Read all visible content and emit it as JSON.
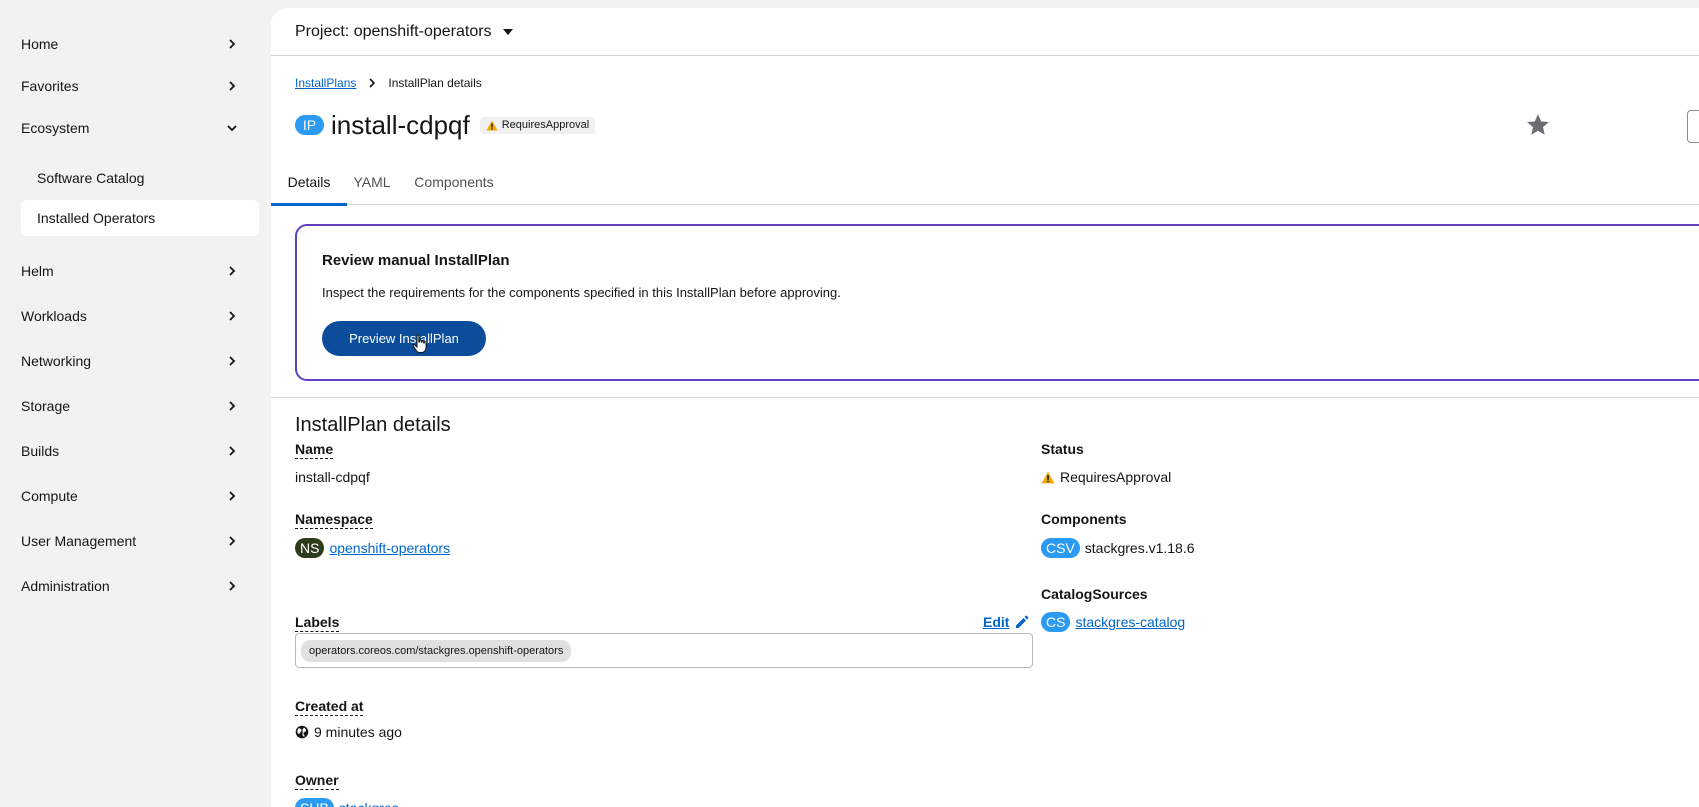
{
  "sidebar": {
    "items": [
      {
        "label": "Home"
      },
      {
        "label": "Favorites"
      },
      {
        "label": "Ecosystem"
      },
      {
        "label": "Helm"
      },
      {
        "label": "Workloads"
      },
      {
        "label": "Networking"
      },
      {
        "label": "Storage"
      },
      {
        "label": "Builds"
      },
      {
        "label": "Compute"
      },
      {
        "label": "User Management"
      },
      {
        "label": "Administration"
      }
    ],
    "ecosystem_children": [
      {
        "label": "Software Catalog"
      },
      {
        "label": "Installed Operators"
      }
    ]
  },
  "project": {
    "label": "Project: openshift-operators"
  },
  "breadcrumb": {
    "parent": "InstallPlans",
    "current": "InstallPlan details"
  },
  "header": {
    "badge": "IP",
    "title": "install-cdpqf",
    "status": "RequiresApproval",
    "status_color": "#f0ab00"
  },
  "tabs": [
    {
      "label": "Details"
    },
    {
      "label": "YAML"
    },
    {
      "label": "Components"
    }
  ],
  "review": {
    "title": "Review manual InstallPlan",
    "description": "Inspect the requirements for the components specified in this InstallPlan before approving.",
    "button": "Preview InstallPlan"
  },
  "details": {
    "section_title": "InstallPlan details",
    "name_label": "Name",
    "name_value": "install-cdpqf",
    "namespace_label": "Namespace",
    "namespace_badge": "NS",
    "namespace_value": "openshift-operators",
    "labels_label": "Labels",
    "edit_label": "Edit",
    "label_chip": "operators.coreos.com/stackgres.openshift-operators",
    "created_label": "Created at",
    "created_value": "9 minutes ago",
    "owner_label": "Owner",
    "owner_badge": "SUB",
    "owner_value": "stackgres",
    "status_label": "Status",
    "status_value": "RequiresApproval",
    "components_label": "Components",
    "components_badge": "CSV",
    "components_value": "stackgres.v1.18.6",
    "catalog_label": "CatalogSources",
    "catalog_badge": "CS",
    "catalog_value": "stackgres-catalog"
  },
  "colors": {
    "primary": "#0b4d9a",
    "link": "#0066cc",
    "card_border": "#5e40be",
    "badge_blue": "#2b9af3",
    "badge_ns": "#2d3d1c"
  },
  "icons": {
    "nav_chevron": "chevron-right-icon",
    "ecosystem_chevron": "chevron-down-icon",
    "warning": "warning-triangle-icon",
    "star": "star-icon",
    "pencil": "pencil-icon",
    "globe": "globe-icon"
  }
}
